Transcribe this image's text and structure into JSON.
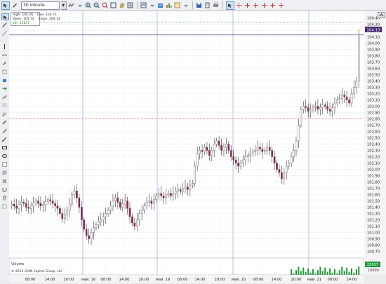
{
  "toolbar": {
    "timeframe": "30 minute",
    "icons": [
      "cursor-icon",
      "dropdown-arrow-icon",
      "zoom-in-icon",
      "zoom-out-icon",
      "magnifier-icon",
      "hand-icon",
      "undo-icon",
      "redo-icon",
      "chart-type-icon",
      "indicator-icon",
      "draw-icon",
      "text-icon",
      "alert-icon",
      "save-icon",
      "print-icon",
      "crosshair-icon",
      "plus-marker-icon",
      "plus-marker-icon",
      "plus-marker-icon",
      "plus-marker-icon",
      "plus-marker-icon"
    ]
  },
  "info_box": {
    "high_label": "High",
    "high_value": "104.26",
    "low_label": "Low",
    "low_value": "103.71",
    "open_label": "Open",
    "open_value": "103.72",
    "close_label": "Close",
    "close_value": "104.13",
    "vol_label": "Vol",
    "vol_value": "22657"
  },
  "chart_data": {
    "type": "candlestick",
    "y_axis_ticks": [
      "104.40",
      "104.30",
      "104.20",
      "104.10",
      "104.00",
      "103.90",
      "103.80",
      "103.70",
      "103.60",
      "103.50",
      "103.40",
      "103.30",
      "103.20",
      "103.10",
      "103.00",
      "102.90",
      "102.80",
      "102.70",
      "102.60",
      "102.50",
      "102.40",
      "102.30",
      "102.20",
      "102.10",
      "102.00",
      "101.90",
      "101.80",
      "101.70",
      "101.60",
      "101.50",
      "101.40",
      "101.30",
      "101.20",
      "101.10",
      "101.00",
      "100.90",
      "100.80",
      "100.70"
    ],
    "ylim": [
      100.65,
      104.45
    ],
    "x_axis_labels": [
      "08:00",
      "14:00",
      "20:00",
      "май. 16",
      "08:00",
      "14:00",
      "20:00",
      "май. 19",
      "08:00",
      "14:00",
      "20:00",
      "май. 20",
      "08:00",
      "14:00",
      "20:00",
      "май. 21",
      "08:00",
      "14:00"
    ],
    "current_price_label": "104.13",
    "current_price": 104.13,
    "horizontal_lines": [
      104.33,
      104.13,
      102.8
    ],
    "volume_panel_label": "Volume",
    "volume_last_label": "22657",
    "volume_axis_label": "10000",
    "close_series": [
      101.45,
      101.42,
      101.38,
      101.44,
      101.48,
      101.46,
      101.4,
      101.38,
      101.42,
      101.47,
      101.5,
      101.46,
      101.42,
      101.44,
      101.49,
      101.52,
      101.5,
      101.46,
      101.42,
      101.38,
      101.3,
      101.22,
      101.28,
      101.35,
      101.45,
      101.6,
      101.66,
      101.55,
      101.4,
      101.2,
      101.05,
      100.95,
      100.9,
      101.0,
      101.08,
      101.12,
      101.18,
      101.2,
      101.25,
      101.3,
      101.35,
      101.42,
      101.5,
      101.55,
      101.48,
      101.4,
      101.45,
      101.5,
      101.38,
      101.25,
      101.15,
      101.1,
      101.2,
      101.3,
      101.35,
      101.42,
      101.48,
      101.5,
      101.46,
      101.52,
      101.58,
      101.62,
      101.58,
      101.55,
      101.6,
      101.62,
      101.58,
      101.62,
      101.66,
      101.68,
      101.65,
      101.7,
      101.72,
      101.68,
      101.75,
      101.78,
      102.05,
      102.25,
      102.3,
      102.28,
      102.35,
      102.3,
      102.22,
      102.3,
      102.4,
      102.45,
      102.38,
      102.3,
      102.35,
      102.4,
      102.3,
      102.2,
      102.15,
      102.1,
      102.05,
      102.1,
      102.15,
      102.2,
      102.22,
      102.25,
      102.28,
      102.3,
      102.35,
      102.32,
      102.28,
      102.3,
      102.35,
      102.3,
      102.2,
      102.1,
      102.0,
      101.95,
      101.85,
      101.95,
      102.05,
      102.1,
      102.2,
      102.3,
      102.45,
      102.7,
      102.95,
      103.0,
      102.98,
      102.92,
      102.95,
      102.98,
      103.0,
      102.95,
      102.98,
      103.02,
      103.0,
      102.95,
      102.92,
      102.98,
      103.05,
      103.1,
      103.12,
      103.18,
      103.15,
      103.1,
      103.05,
      103.2,
      103.3,
      103.4,
      104.13
    ]
  }
}
